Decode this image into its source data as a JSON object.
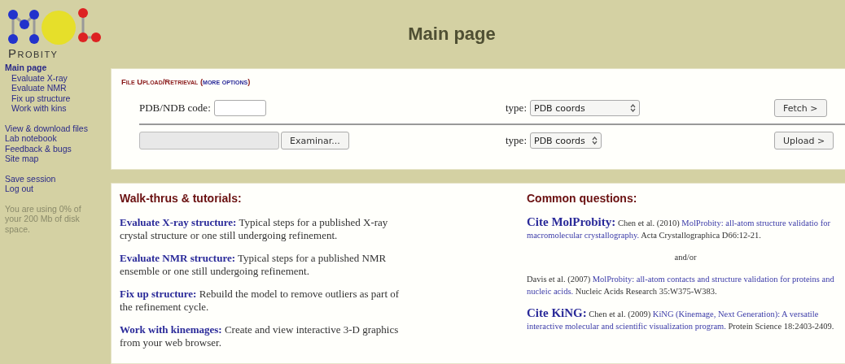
{
  "logo": {
    "wordmark": "Probity"
  },
  "sidebar": {
    "groups": [
      {
        "items": [
          {
            "label": "Main page",
            "selected": true,
            "children": [
              {
                "label": "Evaluate X-ray",
                "selected": false
              },
              {
                "label": "Evaluate NMR",
                "selected": false
              },
              {
                "label": "Fix up structure",
                "selected": false
              },
              {
                "label": "Work with kins",
                "selected": false
              }
            ]
          }
        ]
      },
      {
        "items": [
          {
            "label": "View & download files",
            "selected": false
          },
          {
            "label": "Lab notebook",
            "selected": false
          },
          {
            "label": "Feedback & bugs",
            "selected": false
          },
          {
            "label": "Site map",
            "selected": false
          }
        ]
      },
      {
        "items": [
          {
            "label": "Save session",
            "selected": false
          },
          {
            "label": "Log out",
            "selected": false
          }
        ]
      }
    ],
    "usage_note": "You are using 0% of your 200 Mb of disk space."
  },
  "page_title": "Main page",
  "upload": {
    "title": "File Upload/Retrieval",
    "title_link_open": "(",
    "title_link": "more options",
    "title_link_close": ")",
    "fetch_row": {
      "label": "PDB/NDB code:",
      "type_label": "type:",
      "type_value": "PDB coords",
      "button": "Fetch >"
    },
    "upload_row": {
      "browse_button": "Examinar...",
      "type_label": "type:",
      "type_value": "PDB coords",
      "button": "Upload >"
    }
  },
  "walkthroughs": {
    "heading": "Walk-thrus & tutorials:",
    "items": [
      {
        "link": "Evaluate X-ray structure:",
        "text": "Typical steps for a published X-ray crystal structure or one still undergoing refinement."
      },
      {
        "link": "Evaluate NMR structure:",
        "text": "Typical steps for a published NMR ensemble or one still undergoing refinement."
      },
      {
        "link": "Fix up structure:",
        "text": "Rebuild the model to remove outliers as part of the refinement cycle."
      },
      {
        "link": "Work with kinemages:",
        "text": "Create and view interactive 3-D graphics from your web browser."
      }
    ]
  },
  "questions": {
    "heading": "Common questions:",
    "items": [
      {
        "kind": "citation",
        "title": "Cite MolProbity:",
        "authors": "Chen et al. (2010)",
        "link": "MolProbity: all-atom structure validatio for macromolecular crystallography.",
        "rest": "Acta Crystallographica D66:12-21."
      },
      {
        "kind": "separator",
        "text": "and/or"
      },
      {
        "kind": "citation",
        "authors": "Davis et al. (2007)",
        "link": "MolProbity: all-atom contacts and structure validation for proteins and nucleic acids.",
        "rest": "Nucleic Acids Research 35:W375-W383."
      },
      {
        "kind": "citation",
        "title": "Cite KiNG:",
        "authors": "Chen et al. (2009)",
        "link": "KiNG (Kinemage, Next Generation): A versatile interactive molecular and scientific visualization program.",
        "rest": "Protein Science 18:2403-2409."
      }
    ]
  }
}
